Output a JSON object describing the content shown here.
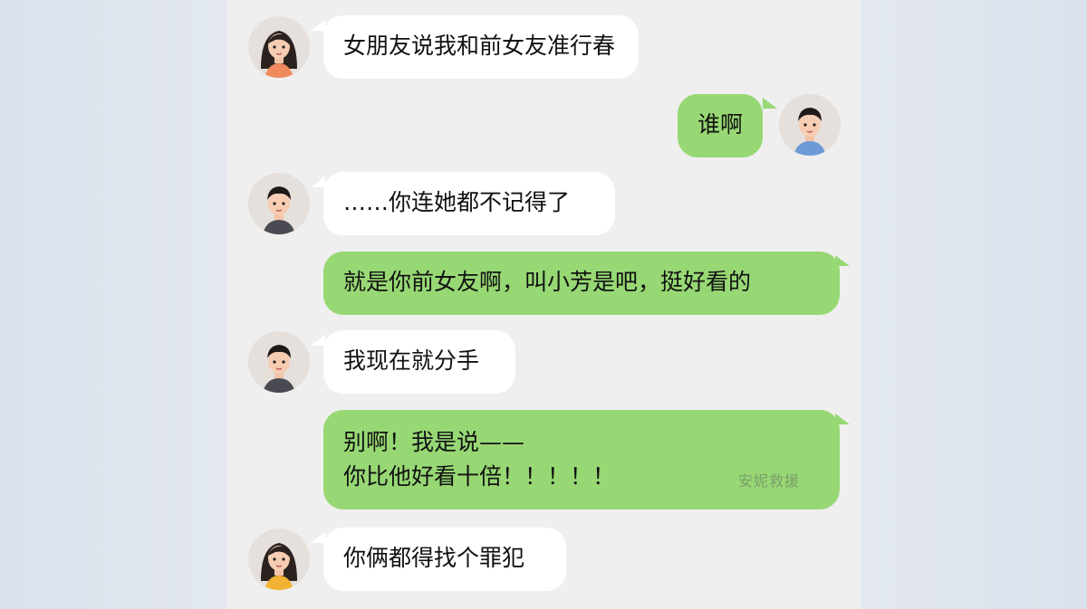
{
  "messages": [
    {
      "side": "left",
      "avatar": "woman-avatar",
      "text": "女朋友说我和前女友准行春"
    },
    {
      "side": "right",
      "avatar": "man-avatar",
      "text": "谁啊"
    },
    {
      "side": "left",
      "avatar": "man-avatar",
      "text": "……你连她都不记得了"
    },
    {
      "side": "right",
      "text": "就是你前女友啊，叫小芳是吧，挺好看的"
    },
    {
      "side": "left",
      "avatar": "man-avatar",
      "text": "我现在就分手"
    },
    {
      "side": "right",
      "lines": [
        "别啊！我是说——",
        "你比他好看十倍！！！！！"
      ],
      "watermark": "安妮救援"
    },
    {
      "side": "left",
      "avatar": "woman-avatar",
      "text": "你俩都得找个罪犯"
    }
  ],
  "colors": {
    "left_bubble": "#ffffff",
    "right_bubble": "#97d874",
    "chat_background": "#efefef",
    "page_background": "#dde4ee"
  }
}
